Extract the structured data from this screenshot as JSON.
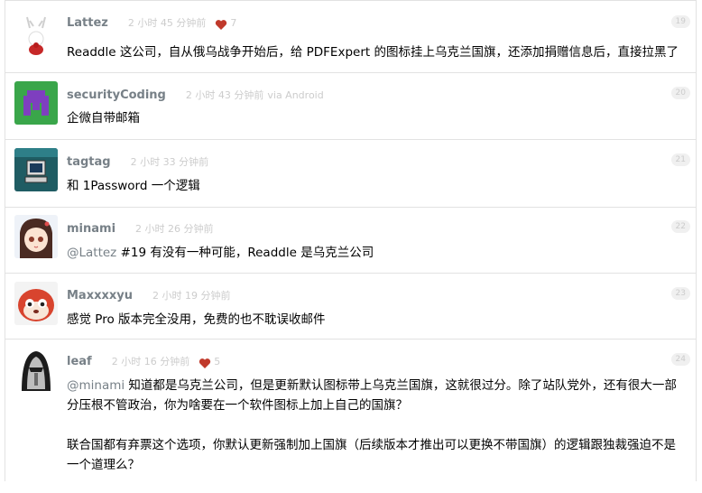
{
  "replies": [
    {
      "user": "Lattez",
      "ago": "2 小时 45 分钟前",
      "via": "",
      "likes": "7",
      "floor": "19",
      "paragraphs": [
        "Readdle 这公司，自从俄乌战争开始后，给 PDFExpert 的图标挂上乌克兰国旗，还添加捐赠信息后，直接拉黑了"
      ]
    },
    {
      "user": "securityCoding",
      "ago": "2 小时 43 分钟前",
      "via": "via Android",
      "likes": "",
      "floor": "20",
      "paragraphs": [
        "企微自带邮箱"
      ]
    },
    {
      "user": "tagtag",
      "ago": "2 小时 33 分钟前",
      "via": "",
      "likes": "",
      "floor": "21",
      "paragraphs": [
        "和 1Password 一个逻辑"
      ]
    },
    {
      "user": "minami",
      "ago": "2 小时 26 分钟前",
      "via": "",
      "likes": "",
      "floor": "22",
      "mention": "@Lattez",
      "paragraphs": [
        " #19 有没有一种可能，Readdle 是乌克兰公司"
      ]
    },
    {
      "user": "Maxxxxyu",
      "ago": "2 小时 19 分钟前",
      "via": "",
      "likes": "",
      "floor": "23",
      "paragraphs": [
        "感觉 Pro 版本完全没用，免费的也不耽误收邮件"
      ]
    },
    {
      "user": "leaf",
      "ago": "2 小时 16 分钟前",
      "via": "",
      "likes": "5",
      "floor": "24",
      "mention": "@minami",
      "paragraphs": [
        " 知道都是乌克兰公司，但是更新默认图标带上乌克兰国旗，这就很过分。除了站队党外，还有很大一部分压根不管政治，你为啥要在一个软件图标上加上自己的国旗？",
        "联合国都有弃票这个选项，你默认更新强制加上国旗（后续版本才推出可以更换不带国旗）的逻辑跟独裁强迫不是一个道理么？"
      ]
    }
  ],
  "colors": {
    "username": "#778087",
    "meta": "#cccccc",
    "heart": "#c0392b",
    "border": "#e2e2e2"
  },
  "icons": {
    "heart": "heart-icon"
  }
}
